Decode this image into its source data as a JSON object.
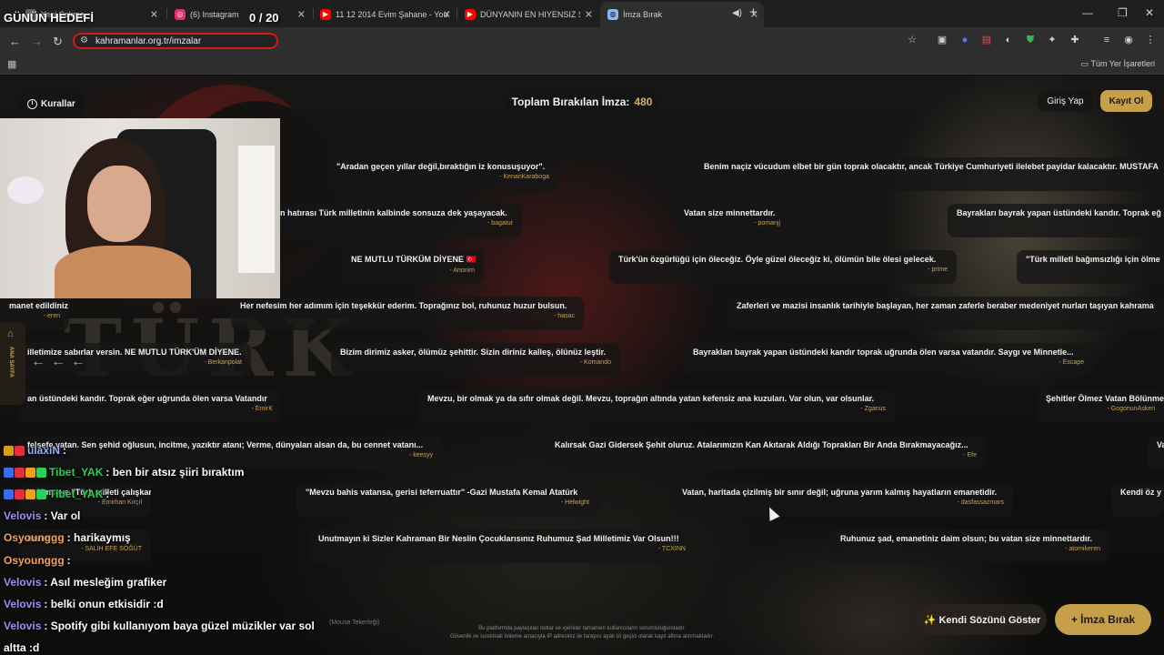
{
  "browser": {
    "tabs": [
      {
        "label": "Yeni Sekme",
        "icon": "new-tab-icon",
        "color": "#5f6368"
      },
      {
        "label": "(6) Instagram",
        "icon": "instagram-icon",
        "color": "#e1306c"
      },
      {
        "label": "11 12 2014 Evim Şahane - YouT",
        "icon": "youtube-icon",
        "color": "#ff0000"
      },
      {
        "label": "DÜNYANIN EN HIYENSIZ SOKAK",
        "icon": "youtube-icon",
        "color": "#ff0000"
      },
      {
        "label": "İmza Bırak",
        "icon": "globe-icon",
        "color": "#8ab4f8",
        "active": true
      }
    ],
    "url": "kahramanlar.org.tr/imzalar",
    "bookmarks_all": "Tüm Yer İşaretleri"
  },
  "stream": {
    "goal_title": "GÜNÜN HEDEFİ",
    "goal_count": "0 / 20"
  },
  "page": {
    "rules_label": "Kurallar",
    "total_label": "Toplam Bırakılan İmza:",
    "total_count": "480",
    "login_label": "Giriş Yap",
    "signup_label": "Kayıt Ol",
    "sidebar_label": "ANA SAYFA",
    "bg_word": "TÜRK",
    "show_own_label": "✨ Kendi Sözünü Göster",
    "sign_label": "+ İmza Bırak",
    "mouse_hint": "(Mouse Tekerleği)",
    "footer_line1": "Bu platformda paylaşılan notlar ve içerikler tamamen kullanıcıların sorumluluğundadır.",
    "footer_line2": "Güvenlik ve suistimali önleme amacıyla IP adresiniz ile tarayıcı ayak izi geçici olarak kayıt altına alınmaktadır."
  },
  "cards": [
    {
      "quote": "\"Aradan geçen yıllar değil,bıraktığın iz konusuşuyor\".",
      "author": "- KenanKaraboga"
    },
    {
      "quote": "Benim naçiz vücudum elbet bir gün toprak olacaktır, ancak Türkiye Cumhuriyeti ilelebet payidar kalacaktır. MUSTAFA",
      "author": ""
    },
    {
      "quote": "n hatırası Türk milletinin kalbinde sonsuza dek yaşayacak.",
      "author": "- bagatur"
    },
    {
      "quote": "Vatan size minnettardır.",
      "author": "- pomanjj"
    },
    {
      "quote": "Bayrakları bayrak yapan üstündeki kandır. Toprak eğ",
      "author": ""
    },
    {
      "quote": "NE MUTLU TÜRKÜM DİYENE 🇹🇷",
      "author": "- Anonim"
    },
    {
      "quote": "Türk'ün özgürlüğü için öleceğiz. Öyle güzel öleceğiz ki, ölümün bile ölesi gelecek.",
      "author": "- prime"
    },
    {
      "quote": "\"Türk milleti bağımsızlığı için ölme",
      "author": ""
    },
    {
      "quote": "manet edildiniz",
      "author": "- eren"
    },
    {
      "quote": "Her nefesim her adımım için teşekkür ederim. Toprağınız bol, ruhunuz huzur bulsun.",
      "author": "- hasac"
    },
    {
      "quote": "Zaferleri ve mazisi insanlık tarihiyle başlayan, her zaman zaferle beraber medeniyet nurları taşıyan kahrama",
      "author": ""
    },
    {
      "quote": "illetimize sabırlar versin. NE MUTLU TÜRK'ÜM DİYENE.",
      "author": "- Berkanpolat"
    },
    {
      "quote": "Bizim dirimiz asker, ölümüz şehittir. Sizin diriniz kalleş, ölünüz leştir.",
      "author": "- Komando"
    },
    {
      "quote": "Bayrakları bayrak yapan üstündeki kandır toprak uğrunda ölen varsa vatandır. Saygı ve Minnetle...",
      "author": "- Escape"
    },
    {
      "quote": "an üstündeki kandır. Toprak eğer uğrunda ölen varsa Vatandır",
      "author": "- EmirK"
    },
    {
      "quote": "Mevzu, bir olmak ya da sıfır olmak değil. Mevzu, toprağın altında yatan kefensiz ana kuzuları. Var olun, var olsunlar.",
      "author": "- Zganus"
    },
    {
      "quote": "Şehitler Ölmez Vatan Bölünme",
      "author": "- GogonunAskeri"
    },
    {
      "quote": "felsefe yatan. Sen şehid oğlusun, incitme, yazıktır atanı; Verme, dünyaları alsan da, bu cennet vatanı...",
      "author": "- keesyy"
    },
    {
      "quote": "Kalırsak Gazi Gidersek Şehit oluruz. Atalarımızın Kan Akıtarak Aldığı Toprakları Bir Anda Bırakmayacağız...",
      "author": "- Efe"
    },
    {
      "quote": "Va",
      "author": ""
    },
    {
      "quote": "lu kimseye \"Türk milleti çalışkandır.\"",
      "author": "- Emirhan Kırçıl"
    },
    {
      "quote": "\"Mevzu bahis vatansa, gerisi teferruattır\" -Gazi Mustafa Kemal Atatürk",
      "author": "- Helwight"
    },
    {
      "quote": "Vatan, haritada çizilmiş bir sınır değil; uğruna yarım kalmış hayatların emanetidir.",
      "author": "- dasfassazmars"
    },
    {
      "quote": "Kendi öz y",
      "author": ""
    },
    {
      "quote": "özveri.\"",
      "author": "- SALİH EFE SÖĞÜT"
    },
    {
      "quote": "Unutmayın ki Sizler Kahraman Bir Neslin Çocuklarısınız Ruhumuz Şad Milletimiz Var Olsun!!!",
      "author": "- TCXINN"
    },
    {
      "quote": "Ruhunuz şad, emanetiniz daim olsun; bu vatan size minnettardır.",
      "author": "- atomikeren"
    }
  ],
  "chat": [
    {
      "user": "ulaxiN",
      "text": ":",
      "color": "#8fb4ff",
      "badges": [
        "#d4a017",
        "#e0303a"
      ]
    },
    {
      "user": "Tibet_YAK",
      "text": ": ben bir atsız şiiri bıraktım",
      "color": "#29d15a",
      "badges": [
        "#3a6ee8",
        "#e0303a",
        "#f0a020",
        "#29d15a"
      ]
    },
    {
      "user": "Tibet_YAK",
      "text": ":",
      "color": "#29d15a",
      "badges": [
        "#3a6ee8",
        "#e0303a",
        "#f0a020",
        "#29d15a"
      ]
    },
    {
      "user": "Velovis",
      "text": ": Var ol",
      "color": "#a78bfa",
      "badges": []
    },
    {
      "user": "Osyounggg",
      "text": ": harikaymış",
      "color": "#f5a35c",
      "badges": []
    },
    {
      "user": "Osyounggg",
      "text": ":",
      "color": "#f5a35c",
      "badges": []
    },
    {
      "user": "Velovis",
      "text": ": Asıl mesleğim grafiker",
      "color": "#a78bfa",
      "badges": []
    },
    {
      "user": "Velovis",
      "text": ": belki onun etkisidir :d",
      "color": "#a78bfa",
      "badges": []
    },
    {
      "user": "Velovis",
      "text": ": Spotify gibi kullanıyom baya güzel müzikler var sol",
      "color": "#a78bfa",
      "badges": []
    },
    {
      "user": "",
      "text": "altta :d",
      "color": "#ffffff",
      "badges": []
    }
  ]
}
